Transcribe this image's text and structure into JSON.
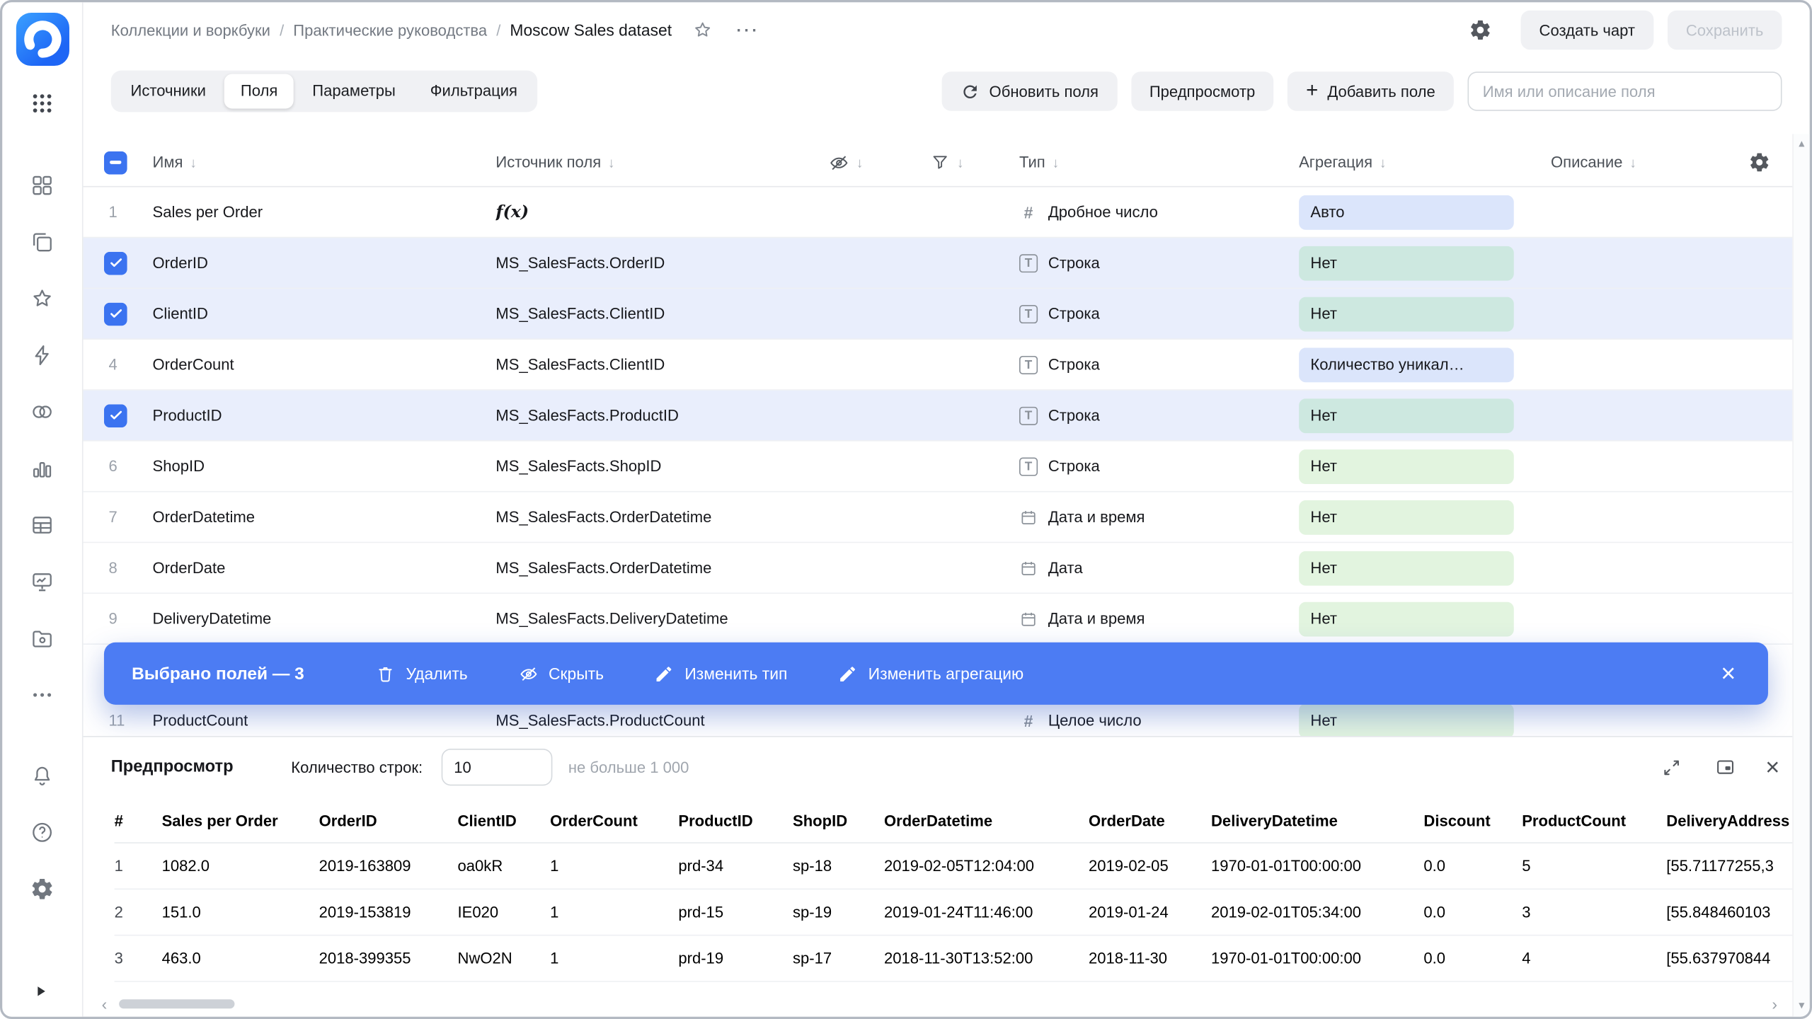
{
  "breadcrumb": {
    "items": [
      "Коллекции и воркбуки",
      "Практические руководства",
      "Moscow Sales dataset"
    ]
  },
  "header": {
    "create_chart": "Создать чарт",
    "save": "Сохранить"
  },
  "tabs": {
    "items": [
      "Источники",
      "Поля",
      "Параметры",
      "Фильтрация"
    ],
    "active": "Поля"
  },
  "toolbar": {
    "refresh": "Обновить поля",
    "preview": "Предпросмотр",
    "add_field": "Добавить поле",
    "search_placeholder": "Имя или описание поля"
  },
  "fields": {
    "columns": {
      "name": "Имя",
      "source": "Источник поля",
      "type": "Тип",
      "aggregation": "Агрегация",
      "description": "Описание"
    },
    "rows": [
      {
        "num": "1",
        "name": "Sales per Order",
        "source": "ƒ(x)",
        "type": "Дробное число",
        "agg": "Авто",
        "selected": false
      },
      {
        "num": "",
        "name": "OrderID",
        "source": "MS_SalesFacts.OrderID",
        "type": "Строка",
        "agg": "Нет",
        "selected": true
      },
      {
        "num": "",
        "name": "ClientID",
        "source": "MS_SalesFacts.ClientID",
        "type": "Строка",
        "agg": "Нет",
        "selected": true
      },
      {
        "num": "4",
        "name": "OrderCount",
        "source": "MS_SalesFacts.ClientID",
        "type": "Строка",
        "agg": "Количество уникал…",
        "selected": false
      },
      {
        "num": "",
        "name": "ProductID",
        "source": "MS_SalesFacts.ProductID",
        "type": "Строка",
        "agg": "Нет",
        "selected": true
      },
      {
        "num": "6",
        "name": "ShopID",
        "source": "MS_SalesFacts.ShopID",
        "type": "Строка",
        "agg": "Нет",
        "selected": false
      },
      {
        "num": "7",
        "name": "OrderDatetime",
        "source": "MS_SalesFacts.OrderDatetime",
        "type": "Дата и время",
        "agg": "Нет",
        "selected": false
      },
      {
        "num": "8",
        "name": "OrderDate",
        "source": "MS_SalesFacts.OrderDatetime",
        "type": "Дата",
        "agg": "Нет",
        "selected": false
      },
      {
        "num": "9",
        "name": "DeliveryDatetime",
        "source": "MS_SalesFacts.DeliveryDatetime",
        "type": "Дата и время",
        "agg": "Нет",
        "selected": false
      },
      {
        "num": "11",
        "name": "ProductCount",
        "source": "MS_SalesFacts.ProductCount",
        "type": "Целое число",
        "agg": "Нет",
        "selected": false
      }
    ]
  },
  "selection_bar": {
    "label": "Выбрано полей — 3",
    "delete": "Удалить",
    "hide": "Скрыть",
    "change_type": "Изменить тип",
    "change_aggregation": "Изменить агрегацию"
  },
  "preview": {
    "title": "Предпросмотр",
    "row_count_label": "Количество строк:",
    "row_count_value": "10",
    "row_count_hint": "не больше 1 000",
    "columns": [
      "#",
      "Sales per Order",
      "OrderID",
      "ClientID",
      "OrderCount",
      "ProductID",
      "ShopID",
      "OrderDatetime",
      "OrderDate",
      "DeliveryDatetime",
      "Discount",
      "ProductCount",
      "DeliveryAddress"
    ],
    "rows": [
      [
        "1",
        "1082.0",
        "2019-163809",
        "oa0kR",
        "1",
        "prd-34",
        "sp-18",
        "2019-02-05T12:04:00",
        "2019-02-05",
        "1970-01-01T00:00:00",
        "0.0",
        "5",
        "[55.71177255,3"
      ],
      [
        "2",
        "151.0",
        "2019-153819",
        "IE020",
        "1",
        "prd-15",
        "sp-19",
        "2019-01-24T11:46:00",
        "2019-01-24",
        "2019-02-01T05:34:00",
        "0.0",
        "3",
        "[55.848460103"
      ],
      [
        "3",
        "463.0",
        "2018-399355",
        "NwO2N",
        "1",
        "prd-19",
        "sp-17",
        "2018-11-30T13:52:00",
        "2018-11-30",
        "1970-01-01T00:00:00",
        "0.0",
        "4",
        "[55.637970844"
      ]
    ]
  },
  "colors": {
    "accent": "#3b73f0",
    "selection_bar": "#4c7cf3",
    "selected_row": "#e9eefc",
    "badge_blue": "#dbe5fb",
    "badge_green": "#e2f4df",
    "badge_teal": "#cde8e0"
  }
}
